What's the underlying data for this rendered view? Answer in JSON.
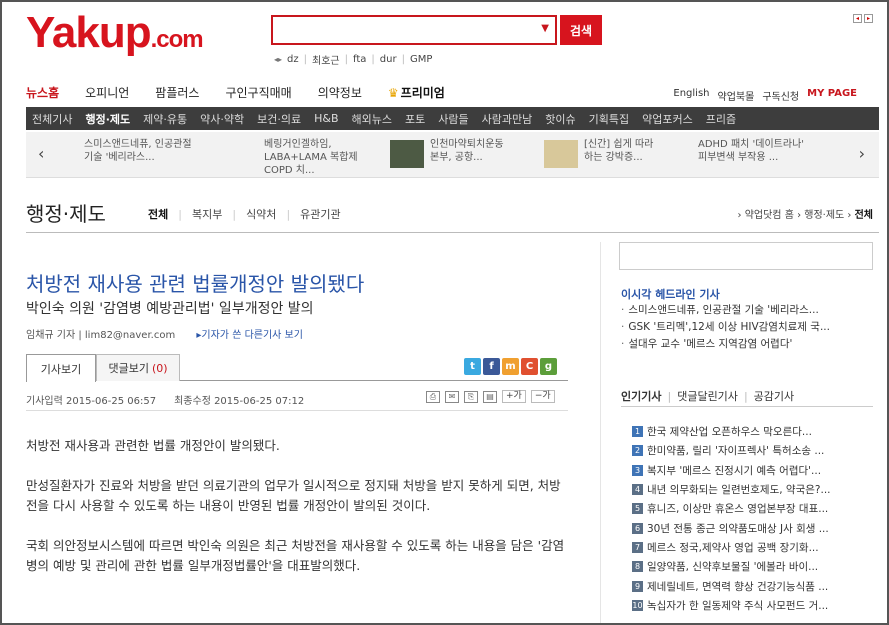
{
  "header": {
    "logo_main": "Yakup",
    "logo_suffix": ".com",
    "search_button": "검색",
    "search_placeholder": "",
    "quick_links": [
      "dz",
      "최호근",
      "fta",
      "dur",
      "GMP"
    ]
  },
  "gnb": {
    "items": [
      "뉴스홈",
      "오피니언",
      "팜플러스",
      "구인구직매매",
      "의약정보"
    ],
    "premium": "프리미엄"
  },
  "util": [
    "English",
    "약업북몰",
    "구독신청",
    "MY PAGE"
  ],
  "subnav": [
    "전체기사",
    "행정·제도",
    "제약·유통",
    "약사·약학",
    "보건·의료",
    "H&B",
    "해외뉴스",
    "포토",
    "사람들",
    "사람과만남",
    "핫이슈",
    "기획특집",
    "약업포커스",
    "프리즘"
  ],
  "carousel": [
    {
      "line1": "스미스앤드네퓨, 인공관절",
      "line2": "기술 '베리라스..."
    },
    {
      "line1": "베링거인겔하임,",
      "line2": "LABA+LAMA 복합제",
      "line3": "COPD 치..."
    },
    {
      "line1": "인천마약퇴치운동",
      "line2": "본부, 공항..."
    },
    {
      "line1": "[신간] 쉽게 따라",
      "line2": "하는 강박증..."
    },
    {
      "line1": "ADHD 패치 '데이트라나'",
      "line2": "피부변색 부작용 ..."
    }
  ],
  "section": {
    "title": "행정·제도",
    "tabs": [
      "전체",
      "복지부",
      "식약처",
      "유관기관"
    ],
    "breadcrumb_prefix": "› 약업닷컴 홈 › 행정·제도 › ",
    "breadcrumb_current": "전체"
  },
  "article": {
    "headline": "처방전 재사용 관련 법률개정안 발의됐다",
    "subhead": "박인숙 의원 '감염병 예방관리법' 일부개정안 발의",
    "byline": "임채규 기자 | lim82@naver.com",
    "more_link": "▸기자가 쓴 다른기사 보기",
    "tab_article": "기사보기",
    "tab_comments": "댓글보기",
    "comment_count": "(0)",
    "input_date": "기사입력 2015-06-25 06:57",
    "modified_date": "최종수정 2015-06-25 07:12",
    "font_up": "+가",
    "font_down": "−가",
    "paragraphs": [
      "처방전 재사용과 관련한 법률 개정안이 발의됐다.",
      "만성질환자가 진료와 처방을 받던 의료기관의 업무가 일시적으로 정지돼 처방을 받지 못하게 되면, 처방전을 다시 사용할 수 있도록 하는 내용이 반영된 법률 개정안이 발의된 것이다.",
      "국회 의안정보시스템에 따르면 박인숙 의원은 최근 처방전을 재사용할 수 있도록 하는 내용을 담은 '감염병의 예방 및 관리에 관한 법률 일부개정법률안'을 대표발의했다."
    ]
  },
  "sidebar": {
    "headline_title": "이시각 헤드라인 기사",
    "headline_items": [
      "스미스앤드네퓨, 인공관절 기술 '베리라스...",
      "GSK '트리멕',12세 이상 HIV감염치료제 국...",
      "설대우 교수 '메르스 지역감염 어렵다'"
    ],
    "popular_tab": "인기기사",
    "comment_tab": "댓글달린기사",
    "sympathy_tab": "공감기사",
    "popular": [
      "한국 제약산업 오픈하우스 막오른다...",
      "한미약품, 릴리 '자이프렉사' 특허소송 ...",
      "복지부 '메르스 진정시기 예측 어렵다'...",
      "내년 의무화되는 일련번호제도, 약국은?...",
      "휴니즈, 이상만 휴온스 영업본부장 대표...",
      "30년 전통 종근 의약품도매상 J사 회생 ...",
      "메르스 정국,제약사 영업 공백 장기화...",
      "일양약품, 신약후보물질 '에볼라 바이...",
      "제네릴네트, 면역력 향상 건강기능식품 ...",
      "녹십자가 한 일동제약 주식 사모펀드 거..."
    ]
  },
  "colors": {
    "brand_red": "#d7141e",
    "headline_blue": "#2a55a8",
    "subnav_bg": "#3d3d3d"
  }
}
